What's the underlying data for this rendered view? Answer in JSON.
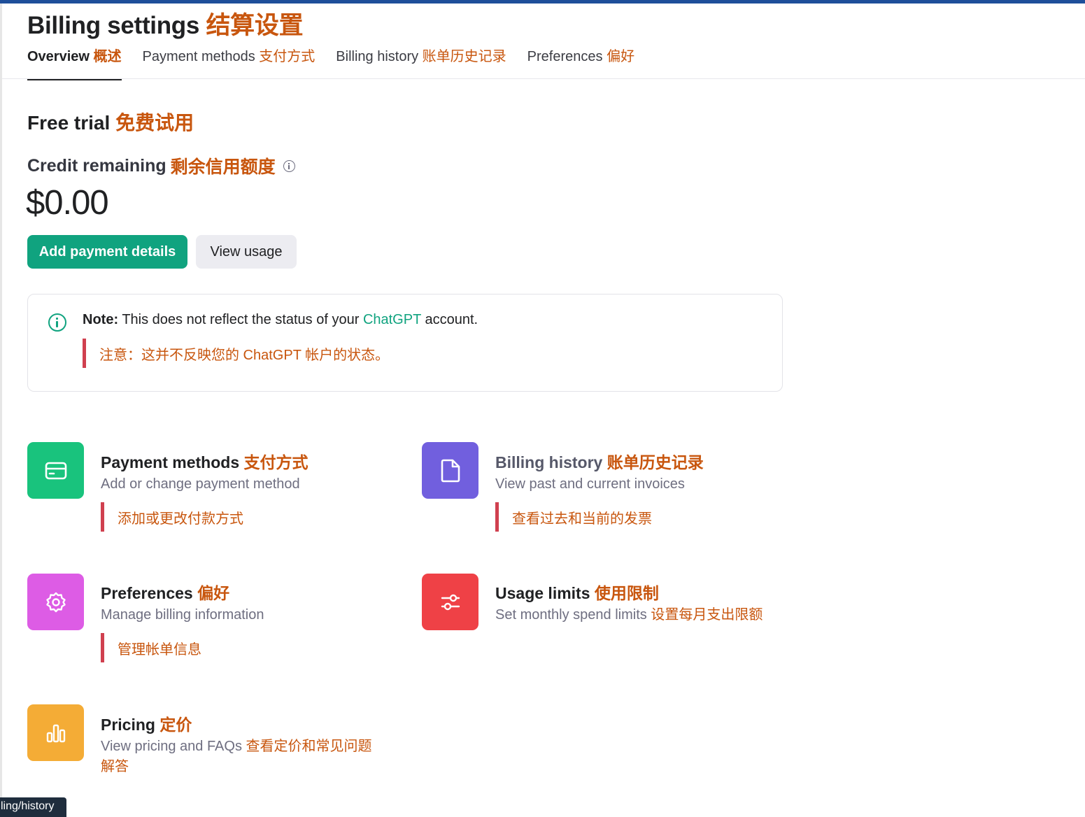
{
  "page": {
    "title_en": "Billing settings",
    "title_zh": "结算设置"
  },
  "tabs": [
    {
      "en": "Overview",
      "zh": "概述",
      "active": true
    },
    {
      "en": "Payment methods",
      "zh": "支付方式",
      "active": false
    },
    {
      "en": "Billing history",
      "zh": "账单历史记录",
      "active": false
    },
    {
      "en": "Preferences",
      "zh": "偏好",
      "active": false
    }
  ],
  "plan": {
    "title_en": "Free trial",
    "title_zh": "免费试用",
    "credit_label_en": "Credit remaining",
    "credit_label_zh": "剩余信用额度",
    "amount": "$0.00"
  },
  "buttons": {
    "add_payment": "Add payment details",
    "view_usage": "View usage"
  },
  "note": {
    "label": "Note:",
    "text_before": "This does not reflect the status of your",
    "link": "ChatGPT",
    "text_after": "account.",
    "zh": "注意：这并不反映您的 ChatGPT 帐户的状态。"
  },
  "cards": [
    {
      "icon": "credit-card-icon",
      "color": "#19c37d",
      "title_en": "Payment methods",
      "title_zh": "支付方式",
      "sub_en": "Add or change payment method",
      "sub_zh": "",
      "zh_line": "添加或更改付款方式"
    },
    {
      "icon": "document-icon",
      "color": "#715fde",
      "title_en": "Billing history",
      "title_zh": "账单历史记录",
      "sub_en": "View past and current invoices",
      "sub_zh": "",
      "zh_line": "查看过去和当前的发票"
    },
    {
      "icon": "gear-icon",
      "color": "#dd5ce5",
      "title_en": "Preferences",
      "title_zh": "偏好",
      "sub_en": "Manage billing information",
      "sub_zh": "",
      "zh_line": "管理帐单信息"
    },
    {
      "icon": "sliders-icon",
      "color": "#ef4146",
      "title_en": "Usage limits",
      "title_zh": "使用限制",
      "sub_en": "Set monthly spend limits",
      "sub_zh": "设置每月支出限额",
      "zh_line": ""
    },
    {
      "icon": "bar-chart-icon",
      "color": "#f4ac36",
      "title_en": "Pricing",
      "title_zh": "定价",
      "sub_en": "View pricing and FAQs",
      "sub_zh": "查看定价和常见问题",
      "sub_zh_2": "解答",
      "zh_line": ""
    }
  ],
  "status_bar": {
    "url": "ling/history"
  }
}
